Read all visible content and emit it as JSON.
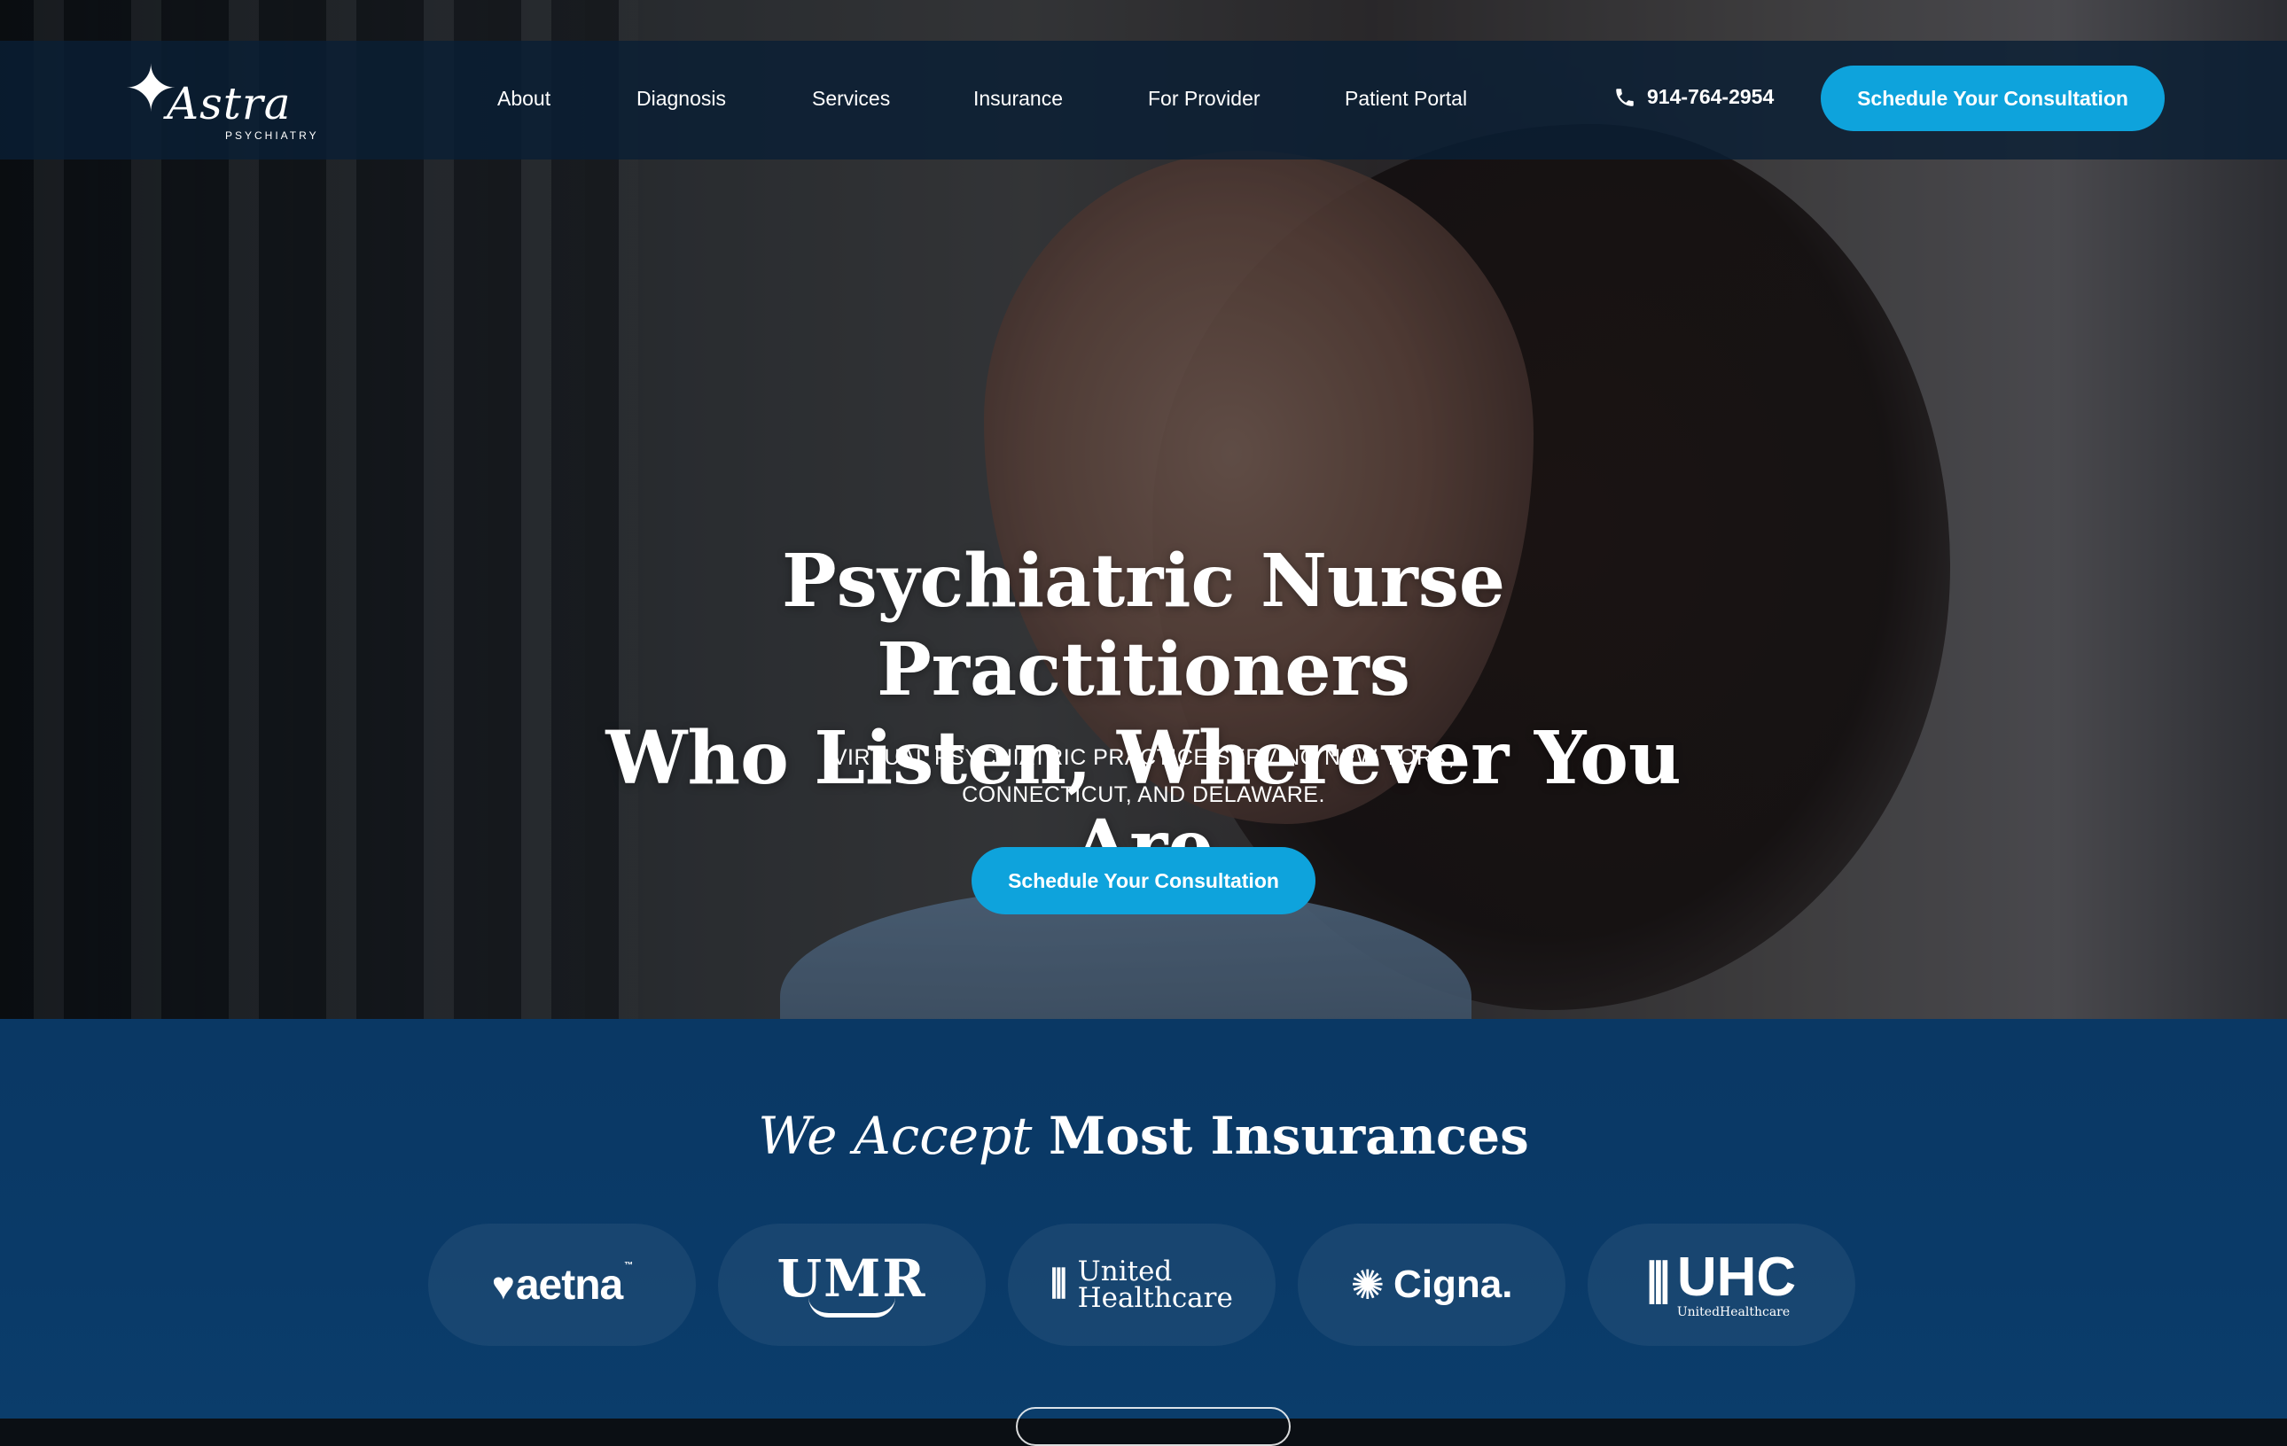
{
  "brand": {
    "logo_mark": "✦",
    "logo_text": "Astra",
    "logo_sub": "PSYCHIATRY"
  },
  "nav": {
    "items": [
      {
        "label": "About"
      },
      {
        "label": "Diagnosis"
      },
      {
        "label": "Services"
      },
      {
        "label": "Insurance"
      },
      {
        "label": "For Provider"
      },
      {
        "label": "Patient Portal"
      }
    ],
    "phone": "914-764-2954",
    "cta_label": "Schedule Your Consultation"
  },
  "hero": {
    "title_line1": "Psychiatric Nurse Practitioners",
    "title_line2": "Who Listen, Wherever You Are",
    "subtitle_line1": "VIRTUAL PSYCHIATRIC PRACTICE SERVING NEW YORK,",
    "subtitle_line2": "CONNECTICUT, AND DELAWARE.",
    "cta_label": "Schedule Your Consultation"
  },
  "insurance": {
    "title_italic": "We Accept",
    "title_bold": "Most Insurances",
    "logos": [
      {
        "name": "aetna",
        "text": "aetna"
      },
      {
        "name": "umr",
        "text": "UMR"
      },
      {
        "name": "united-healthcare",
        "line1": "United",
        "line2": "Healthcare"
      },
      {
        "name": "cigna",
        "text": "Cigna."
      },
      {
        "name": "uhc",
        "text": "UHC",
        "sub": "UnitedHealthcare"
      }
    ]
  },
  "colors": {
    "accent": "#0ea3dc",
    "navy": "#0a3864",
    "nav_bg": "#0a1e34"
  },
  "icons": [
    "phone-icon",
    "heart-icon",
    "shield-icon",
    "tree-icon"
  ]
}
